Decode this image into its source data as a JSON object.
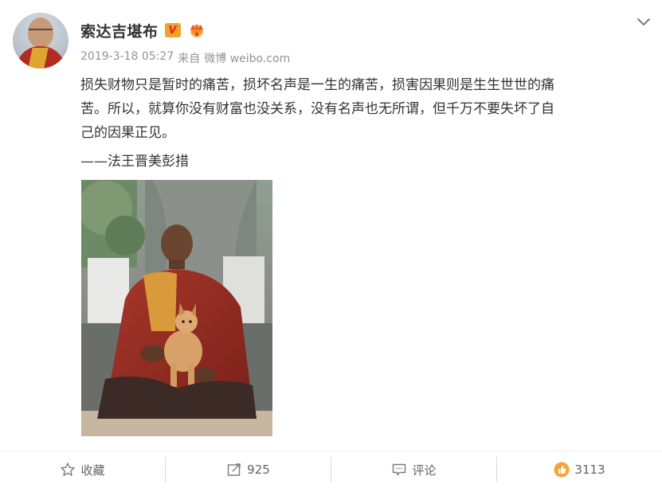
{
  "post": {
    "author": {
      "name": "索达吉堪布",
      "verified_badge": "V",
      "avatar_icon": "monk-avatar-icon",
      "crown_icon": "crown-badge-icon"
    },
    "meta": {
      "timestamp": "2019-3-18 05:27",
      "source_prefix": "来自",
      "source": "微博 weibo.com"
    },
    "content": {
      "lines": [
        "损失财物只是暂时的痛苦，损坏名声是一生的痛苦，损害因果则是生生世世的痛",
        "苦。所以，就算你没有财富也没关系，没有名声也无所谓，但千万不要失坏了自",
        "己的因果正见。"
      ],
      "signature": "——法王晋美彭措"
    },
    "menu_icon": "chevron-down-icon"
  },
  "toolbar": {
    "favorite": {
      "icon": "star-icon",
      "label": "收藏"
    },
    "repost": {
      "icon": "share-icon",
      "label": "925"
    },
    "comment": {
      "icon": "comment-icon",
      "label": "评论"
    },
    "like": {
      "icon": "thumbs-up-icon",
      "label": "3113"
    }
  },
  "colors": {
    "text": "#333333",
    "meta": "#939393",
    "toolbar_text": "#636363",
    "verified_bg": "#f0a32a",
    "verified_fg": "#e7222a",
    "like_icon": "#f7a33b"
  }
}
